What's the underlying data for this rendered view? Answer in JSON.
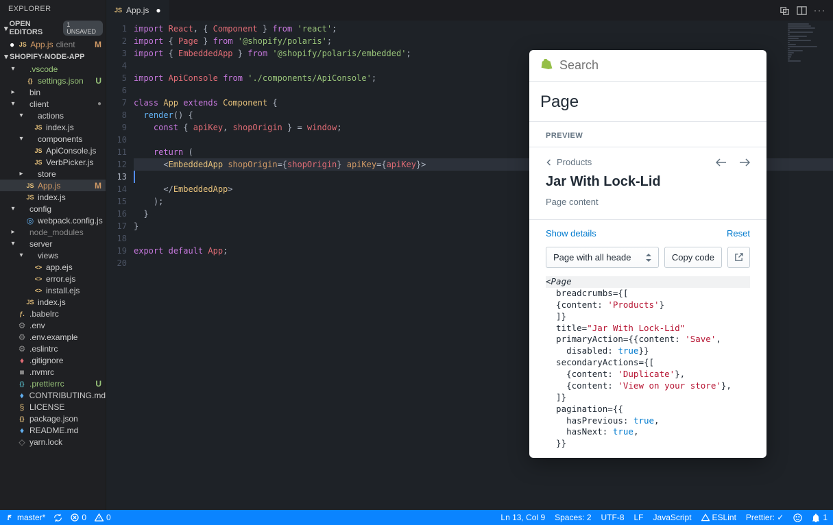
{
  "sidebar": {
    "header": "EXPLORER",
    "sections": {
      "open_editors": {
        "label": "OPEN EDITORS",
        "unsaved": "1 UNSAVED"
      },
      "project": "SHOPIFY-NODE-APP"
    },
    "open_editor_item": {
      "name": "App.js",
      "folder": "client",
      "status": "M"
    },
    "tree": [
      {
        "pad": 14,
        "chev": "▾",
        "icon": "",
        "name": ".vscode",
        "class": "c-green",
        "status": ""
      },
      {
        "pad": 26,
        "chev": "",
        "icon": "{}",
        "iconClass": "c-yellow",
        "name": "settings.json",
        "class": "c-green",
        "status": "U"
      },
      {
        "pad": 14,
        "chev": "▸",
        "icon": "",
        "name": "bin",
        "class": "",
        "status": ""
      },
      {
        "pad": 14,
        "chev": "▾",
        "icon": "",
        "name": "client",
        "class": "",
        "status": "",
        "dot": true
      },
      {
        "pad": 26,
        "chev": "▾",
        "icon": "",
        "name": "actions",
        "class": "",
        "status": ""
      },
      {
        "pad": 38,
        "chev": "",
        "icon": "JS",
        "iconClass": "c-yellow",
        "name": "index.js",
        "class": "",
        "status": ""
      },
      {
        "pad": 26,
        "chev": "▾",
        "icon": "",
        "name": "components",
        "class": "",
        "status": ""
      },
      {
        "pad": 38,
        "chev": "",
        "icon": "JS",
        "iconClass": "c-yellow",
        "name": "ApiConsole.js",
        "class": "",
        "status": ""
      },
      {
        "pad": 38,
        "chev": "",
        "icon": "JS",
        "iconClass": "c-yellow",
        "name": "VerbPicker.js",
        "class": "",
        "status": ""
      },
      {
        "pad": 26,
        "chev": "▸",
        "icon": "",
        "name": "store",
        "class": "",
        "status": ""
      },
      {
        "pad": 26,
        "chev": "",
        "icon": "JS",
        "iconClass": "c-yellow",
        "name": "App.js",
        "class": "c-orange",
        "status": "M",
        "active": true
      },
      {
        "pad": 26,
        "chev": "",
        "icon": "JS",
        "iconClass": "c-yellow",
        "name": "index.js",
        "class": "",
        "status": ""
      },
      {
        "pad": 14,
        "chev": "▾",
        "icon": "",
        "name": "config",
        "class": "",
        "status": ""
      },
      {
        "pad": 26,
        "chev": "",
        "icon": "◎",
        "iconClass": "c-blue",
        "name": "webpack.config.js",
        "class": "",
        "status": ""
      },
      {
        "pad": 14,
        "chev": "▸",
        "icon": "",
        "name": "node_modules",
        "class": "c-gray",
        "status": ""
      },
      {
        "pad": 14,
        "chev": "▾",
        "icon": "",
        "name": "server",
        "class": "",
        "status": ""
      },
      {
        "pad": 26,
        "chev": "▾",
        "icon": "",
        "name": "views",
        "class": "",
        "status": ""
      },
      {
        "pad": 38,
        "chev": "",
        "icon": "<>",
        "iconClass": "c-yellow",
        "name": "app.ejs",
        "class": "",
        "status": ""
      },
      {
        "pad": 38,
        "chev": "",
        "icon": "<>",
        "iconClass": "c-yellow",
        "name": "error.ejs",
        "class": "",
        "status": ""
      },
      {
        "pad": 38,
        "chev": "",
        "icon": "<>",
        "iconClass": "c-yellow",
        "name": "install.ejs",
        "class": "",
        "status": ""
      },
      {
        "pad": 26,
        "chev": "",
        "icon": "JS",
        "iconClass": "c-yellow",
        "name": "index.js",
        "class": "",
        "status": ""
      },
      {
        "pad": 14,
        "chev": "",
        "icon": "ƒ.",
        "iconClass": "c-yellow",
        "name": ".babelrc",
        "class": "",
        "status": ""
      },
      {
        "pad": 14,
        "chev": "",
        "icon": "⚙",
        "iconClass": "c-gray",
        "name": ".env",
        "class": "",
        "status": ""
      },
      {
        "pad": 14,
        "chev": "",
        "icon": "⚙",
        "iconClass": "c-gray",
        "name": ".env.example",
        "class": "",
        "status": ""
      },
      {
        "pad": 14,
        "chev": "",
        "icon": "⚙",
        "iconClass": "c-gray",
        "name": ".eslintrc",
        "class": "",
        "status": ""
      },
      {
        "pad": 14,
        "chev": "",
        "icon": "♦",
        "iconClass": "c-red",
        "name": ".gitignore",
        "class": "",
        "status": ""
      },
      {
        "pad": 14,
        "chev": "",
        "icon": "■",
        "iconClass": "c-gray",
        "name": ".nvmrc",
        "class": "",
        "status": ""
      },
      {
        "pad": 14,
        "chev": "",
        "icon": "{}",
        "iconClass": "c-cyan",
        "name": ".prettierrc",
        "class": "c-green",
        "status": "U"
      },
      {
        "pad": 14,
        "chev": "",
        "icon": "♦",
        "iconClass": "c-blue",
        "name": "CONTRIBUTING.md",
        "class": "",
        "status": ""
      },
      {
        "pad": 14,
        "chev": "",
        "icon": "§",
        "iconClass": "c-yellow",
        "name": "LICENSE",
        "class": "",
        "status": ""
      },
      {
        "pad": 14,
        "chev": "",
        "icon": "{}",
        "iconClass": "c-yellow",
        "name": "package.json",
        "class": "",
        "status": ""
      },
      {
        "pad": 14,
        "chev": "",
        "icon": "♦",
        "iconClass": "c-blue",
        "name": "README.md",
        "class": "",
        "status": ""
      },
      {
        "pad": 14,
        "chev": "",
        "icon": "◇",
        "iconClass": "c-gray",
        "name": "yarn.lock",
        "class": "",
        "status": ""
      }
    ]
  },
  "tab": {
    "icon": "JS",
    "name": "App.js"
  },
  "code": {
    "lines": [
      "<span class='tok-import'>import</span> <span class='tok-var'>React</span><span class='tok-punc'>, { </span><span class='tok-var'>Component</span><span class='tok-punc'> } </span><span class='tok-import'>from</span> <span class='tok-string'>'react'</span><span class='tok-punc'>;</span>",
      "<span class='tok-import'>import</span><span class='tok-punc'> { </span><span class='tok-var'>Page</span><span class='tok-punc'> } </span><span class='tok-import'>from</span> <span class='tok-string'>'@shopify/polaris'</span><span class='tok-punc'>;</span>",
      "<span class='tok-import'>import</span><span class='tok-punc'> { </span><span class='tok-var'>EmbeddedApp</span><span class='tok-punc'> } </span><span class='tok-import'>from</span> <span class='tok-string'>'@shopify/polaris/embedded'</span><span class='tok-punc'>;</span>",
      "",
      "<span class='tok-import'>import</span> <span class='tok-var'>ApiConsole</span> <span class='tok-import'>from</span> <span class='tok-string'>'./components/ApiConsole'</span><span class='tok-punc'>;</span>",
      "",
      "<span class='tok-keyword'>class</span> <span class='tok-class'>App</span> <span class='tok-keyword'>extends</span> <span class='tok-class'>Component</span> <span class='tok-punc'>{</span>",
      "  <span class='tok-fn'>render</span><span class='tok-punc'>() {</span>",
      "    <span class='tok-keyword'>const</span><span class='tok-punc'> { </span><span class='tok-var'>apiKey</span><span class='tok-punc'>, </span><span class='tok-var'>shopOrigin</span><span class='tok-punc'> } = </span><span class='tok-var'>window</span><span class='tok-punc'>;</span>",
      "",
      "    <span class='tok-keyword'>return</span> <span class='tok-punc'>(</span>",
      "      <span class='tok-punc'>&lt;</span><span class='tok-class'>EmbeddedApp</span> <span class='tok-attr'>shopOrigin</span><span class='tok-punc'>=</span><span class='tok-punc'>{</span><span class='tok-var'>shopOrigin</span><span class='tok-punc'>}</span> <span class='tok-attr'>apiKey</span><span class='tok-punc'>=</span><span class='tok-punc'>{</span><span class='tok-var'>apiKey</span><span class='tok-punc'>}</span><span class='tok-punc'>&gt;</span>",
      "        ",
      "      <span class='tok-punc'>&lt;/</span><span class='tok-class'>EmbeddedApp</span><span class='tok-punc'>&gt;</span>",
      "    <span class='tok-punc'>);</span>",
      "  <span class='tok-punc'>}</span>",
      "<span class='tok-punc'>}</span>",
      "",
      "<span class='tok-import'>export</span> <span class='tok-import'>default</span> <span class='tok-var'>App</span><span class='tok-punc'>;</span>",
      ""
    ],
    "activeLine": 13
  },
  "panel": {
    "search_placeholder": "Search",
    "header": "Page",
    "preview_label": "PREVIEW",
    "crumb": "Products",
    "title": "Jar With Lock-Lid",
    "content": "Page content",
    "show_details": "Show details",
    "reset": "Reset",
    "select": "Page with all heade",
    "copy": "Copy code",
    "snippet": [
      {
        "t": "&lt;<i>Page</i>",
        "hl": true
      },
      {
        "t": "  breadcrumbs={[",
        "hl": false
      },
      {
        "t": "  {content: <span class='sn-str'>'Products'</span>}",
        "hl": false
      },
      {
        "t": "  ]}",
        "hl": false
      },
      {
        "t": "  title=<span class='sn-str'>\"Jar With Lock-Lid\"</span>",
        "hl": false
      },
      {
        "t": "  primaryAction={{content: <span class='sn-str'>'Save'</span>,",
        "hl": false
      },
      {
        "t": "    disabled: <span class='sn-kw'>true</span>}}",
        "hl": false
      },
      {
        "t": "  secondaryActions={[",
        "hl": false
      },
      {
        "t": "    {content: <span class='sn-str'>'Duplicate'</span>},",
        "hl": false
      },
      {
        "t": "    {content: <span class='sn-str'>'View on your store'</span>},",
        "hl": false
      },
      {
        "t": "  ]}",
        "hl": false
      },
      {
        "t": "  pagination={{",
        "hl": false
      },
      {
        "t": "    hasPrevious: <span class='sn-kw'>true</span>,",
        "hl": false
      },
      {
        "t": "    hasNext: <span class='sn-kw'>true</span>,",
        "hl": false
      },
      {
        "t": "  }}",
        "hl": false
      }
    ]
  },
  "statusbar": {
    "branch": "master*",
    "errors": "0",
    "warnings": "0",
    "lncol": "Ln 13, Col 9",
    "spaces": "Spaces: 2",
    "encoding": "UTF-8",
    "eol": "LF",
    "lang": "JavaScript",
    "eslint": "ESLint",
    "prettier": "Prettier: ✓",
    "bell": "1"
  }
}
